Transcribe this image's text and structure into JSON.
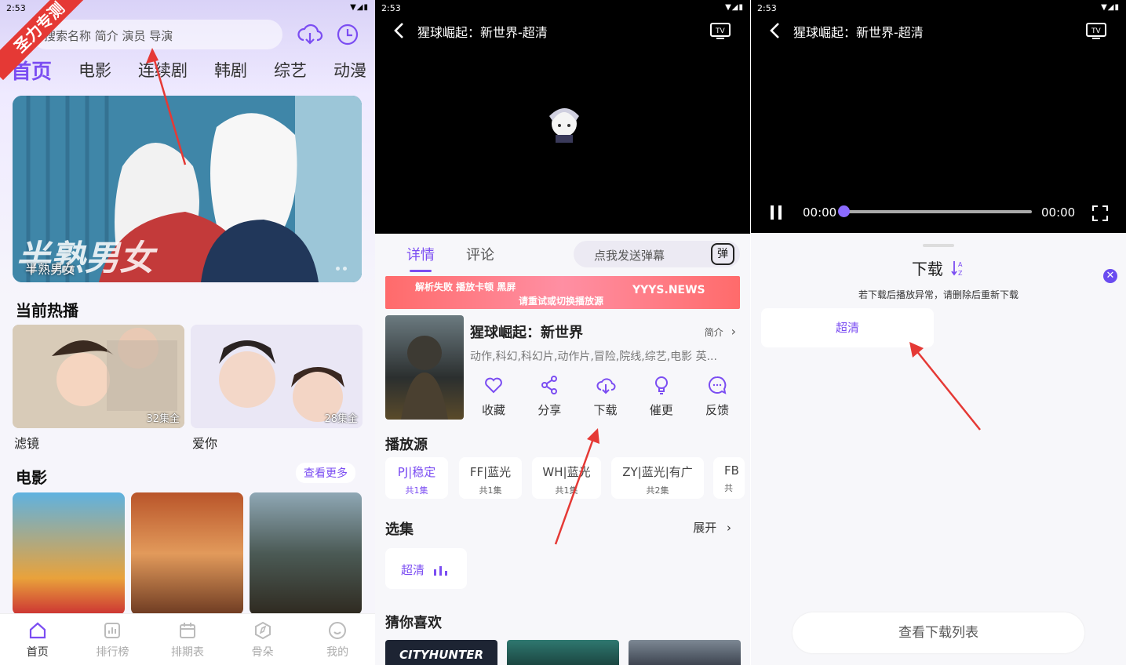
{
  "left": {
    "status_time": "2:53",
    "ribbon": "圣力专测",
    "search_placeholder": "搜索名称 简介 演员 导演",
    "categories": [
      "首页",
      "电影",
      "连续剧",
      "韩剧",
      "综艺",
      "动漫"
    ],
    "hero_title": "半熟男女",
    "hot_title": "当前热播",
    "hot": [
      {
        "title": "滤镜",
        "badge": "32集全"
      },
      {
        "title": "爱你",
        "badge": "28集全"
      }
    ],
    "movies_title": "电影",
    "more_label": "查看更多",
    "tabs": [
      "首页",
      "排行榜",
      "排期表",
      "骨朵",
      "我的"
    ]
  },
  "mid": {
    "status_time": "2:53",
    "video_title": "猩球崛起：新世界-超清",
    "tabs": [
      "详情",
      "评论"
    ],
    "danmu_placeholder": "点我发送弹幕",
    "danmu_icon": "弹",
    "ad_line1": "解析失败  播放卡顿  黑屏",
    "ad_line2": "请重试或切换播放源",
    "ad_watermark": "YYYS.NEWS",
    "movie_title": "猩球崛起：新世界",
    "intro_label": "简介",
    "genres": "动作,科幻,科幻片,动作片,冒险,院线,综艺,电影 英...",
    "actions": [
      "收藏",
      "分享",
      "下载",
      "催更",
      "反馈"
    ],
    "sources_title": "播放源",
    "sources": [
      {
        "name": "PJ|稳定",
        "count": "共1集"
      },
      {
        "name": "FF|蓝光",
        "count": "共1集"
      },
      {
        "name": "WH|蓝光",
        "count": "共1集"
      },
      {
        "name": "ZY|蓝光|有广",
        "count": "共2集"
      },
      {
        "name": "FB",
        "count": "共"
      }
    ],
    "episodes_title": "选集",
    "expand_label": "展开",
    "episode": "超清",
    "guess_title": "猜你喜欢",
    "guess_first": "CITYHUNTER"
  },
  "right": {
    "status_time": "2:53",
    "video_title": "猩球崛起：新世界-超清",
    "time_start": "00:00",
    "time_end": "00:00",
    "progress": 0,
    "download_title": "下载",
    "download_note": "若下载后播放异常，请删除后重新下载",
    "quality": "超清",
    "list_button": "查看下载列表"
  },
  "colors": {
    "accent": "#7b4df2",
    "ribbon": "#e53935",
    "arrow": "#e53935"
  }
}
